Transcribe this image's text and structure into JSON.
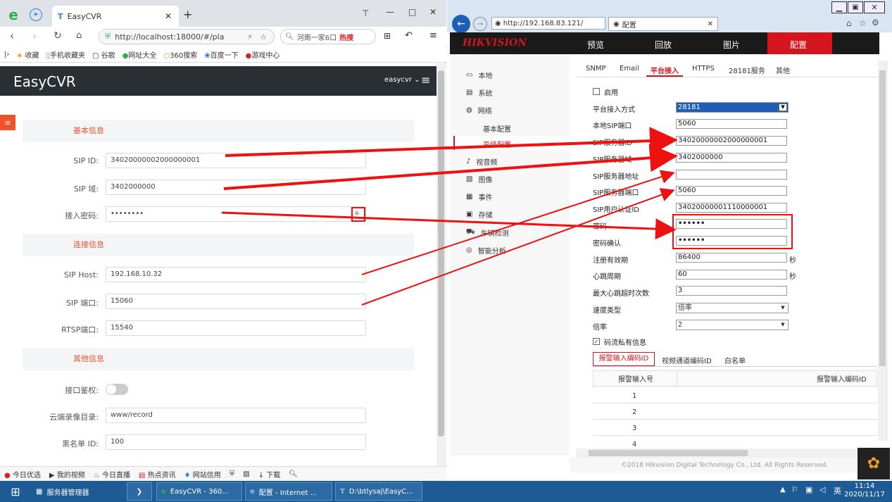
{
  "left_browser": {
    "tab_title": "EasyCVR",
    "url": "http://localhost:18000/#/pla",
    "search_text": "河南一家6口",
    "search_hot": "热搜",
    "favorites": [
      "收藏",
      "手机收藏夹",
      "谷歌",
      "网址大全",
      "360搜索",
      "百度一下",
      "游戏中心"
    ],
    "status_items": [
      "今日优选",
      "我的视频",
      "今日直播",
      "热点资讯",
      "网站信用",
      "下载"
    ]
  },
  "easycvr": {
    "title": "EasyCVR",
    "user": "easycvr",
    "sections": {
      "basic": "基本信息",
      "connection": "连接信息",
      "other": "其他信息"
    },
    "fields": {
      "sip_id_label": "SIP ID:",
      "sip_id_value": "34020000002000000001",
      "sip_domain_label": "SIP 域:",
      "sip_domain_value": "3402000000",
      "password_label": "接入密码:",
      "password_value": "••••••••",
      "sip_host_label": "SIP Host:",
      "sip_host_value": "192.168.10.32",
      "sip_port_label": "SIP 端口:",
      "sip_port_value": "15060",
      "rtsp_port_label": "RTSP端口:",
      "rtsp_port_value": "15540",
      "auth_label": "接口鉴权:",
      "record_dir_label": "云端录像目录:",
      "record_dir_value": "www/record",
      "blacklist_label": "黑名单 ID:",
      "blacklist_value": "100"
    }
  },
  "ie_browser": {
    "url": "http://192.168.83.121/",
    "tab_title": "配置"
  },
  "hikvision": {
    "logo": "HIKVISION",
    "nav": [
      "预览",
      "回放",
      "图片",
      "配置"
    ],
    "sidebar": [
      "本地",
      "系统",
      "网络",
      "视音频",
      "图像",
      "事件",
      "存储",
      "车辆检测",
      "智能分析"
    ],
    "sidebar_sub": [
      "基本配置",
      "高级配置"
    ],
    "subtabs": [
      "SNMP",
      "Email",
      "平台接入",
      "HTTPS",
      "28181服务",
      "其他"
    ],
    "form": {
      "enable_label": "启用",
      "access_mode_label": "平台接入方式",
      "access_mode_value": "28181",
      "local_sip_port_label": "本地SIP端口",
      "local_sip_port_value": "5060",
      "sip_server_id_label": "SIP服务器ID",
      "sip_server_id_value": "34020000002000000001",
      "sip_server_domain_label": "SIP服务器域",
      "sip_server_domain_value": "3402000000",
      "sip_server_addr_label": "SIP服务器地址",
      "sip_server_addr_value": "",
      "sip_server_port_label": "SIP服务器端口",
      "sip_server_port_value": "5060",
      "sip_user_label": "SIP用户认证ID",
      "sip_user_value": "34020000001110000001",
      "password_label": "密码",
      "password_value": "••••••",
      "password_confirm_label": "密码确认",
      "password_confirm_value": "••••••",
      "reg_valid_label": "注册有效期",
      "reg_valid_value": "86400",
      "heartbeat_label": "心跳周期",
      "heartbeat_value": "60",
      "max_timeout_label": "最大心跳超时次数",
      "max_timeout_value": "3",
      "speed_type_label": "速度类型",
      "speed_type_value": "倍率",
      "rate_label": "倍率",
      "rate_value": "2",
      "unit_sec": "秒",
      "stream_private_label": "码流私有信息"
    },
    "table_tabs": [
      "报警输入编码ID",
      "视频通道编码ID",
      "白名单"
    ],
    "table_headers": [
      "报警输入号",
      "报警输入编码ID"
    ],
    "table_rows": [
      "1",
      "2",
      "3",
      "4"
    ],
    "footer": "©2018 Hikvision Digital Technology Co., Ltd. All Rights Reserved."
  },
  "taskbar": {
    "items": [
      "服务器管理器",
      "EasyCVR - 360...",
      "配置 - Internet ...",
      "D:\\btlysaj\\EasyC..."
    ],
    "lang": "英",
    "time": "11:14",
    "date": "2020/11/17"
  }
}
